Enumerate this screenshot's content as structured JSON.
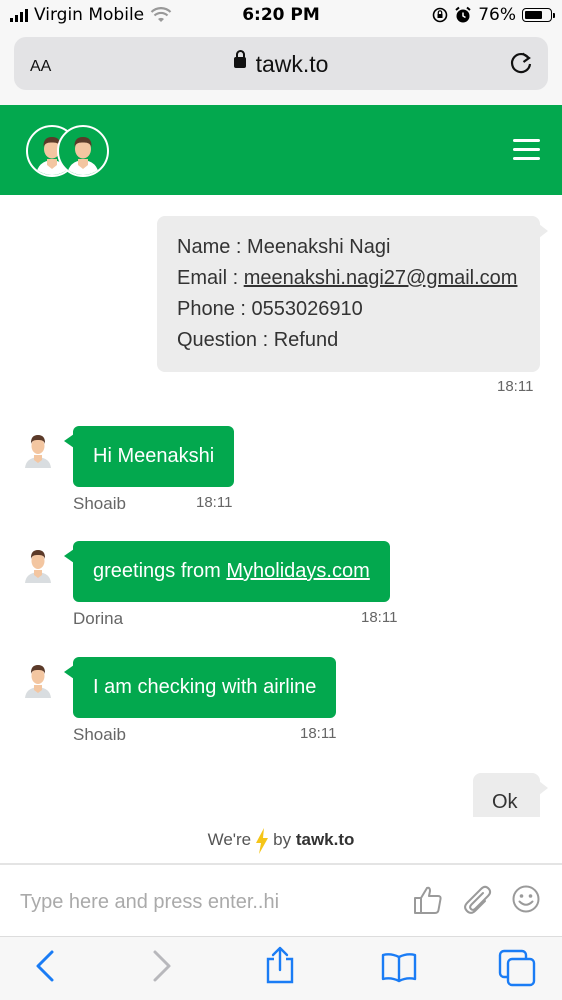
{
  "status_bar": {
    "carrier": "Virgin Mobile",
    "time": "6:20 PM",
    "battery_percent": "76%",
    "battery_level": 0.76
  },
  "browser": {
    "text_size_label": "AA",
    "url": "tawk.to"
  },
  "chat": {
    "visitor_message": {
      "lines": [
        {
          "label": "Name : ",
          "value": "Meenakshi Nagi"
        },
        {
          "label": "Email : ",
          "value": "meenakshi.nagi27@gmail.com"
        },
        {
          "label": "Phone : ",
          "value": "0553026910"
        },
        {
          "label": "Question : ",
          "value": "Refund"
        }
      ],
      "time": "18:11"
    },
    "agent_messages": [
      {
        "text": "Hi Meenakshi",
        "name": "Shoaib",
        "time": "18:11"
      },
      {
        "text_prefix": "greetings from ",
        "link": "Myholidays.com",
        "name": "Dorina",
        "time": "18:11"
      },
      {
        "text": "I am checking with airline",
        "name": "Shoaib",
        "time": "18:11"
      }
    ],
    "visitor_reply": "Ok"
  },
  "powered_by": {
    "prefix": "We're",
    "middle": "by",
    "brand": "tawk.to"
  },
  "composer": {
    "placeholder": "Type here and press enter..hi"
  },
  "colors": {
    "brand_green": "#03a84e",
    "visitor_bubble": "#ececec",
    "ios_blue": "#1a7cf5"
  }
}
